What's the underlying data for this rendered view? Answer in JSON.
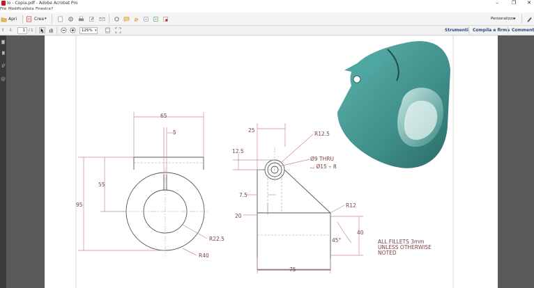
{
  "window": {
    "title": "lo - Copia.pdf - Adobe Acrobat Pro",
    "controls": [
      "–",
      "❐",
      "✕"
    ]
  },
  "menu": [
    "File",
    "Modifica",
    "Vista",
    "Finestra",
    "?"
  ],
  "toolbar": {
    "open_label": "Apri",
    "create_label": "Crea",
    "customize_label": "Personalizza"
  },
  "nav": {
    "page_current": "1",
    "page_total": "/ 1",
    "zoom": "125%"
  },
  "panes": {
    "tools": "Strumenti",
    "fill_sign": "Compila e firma",
    "comment": "Commento"
  },
  "drawing": {
    "dims": {
      "d65": "65",
      "d5": "5",
      "d55": "55",
      "d95": "95",
      "r225": "R22.5",
      "r40": "R40",
      "d25": "25",
      "r125": "R12.5",
      "d125": "12.5",
      "hole": "Ø9 THRU",
      "cbore": "⌴ Ø15 ⫟ 8",
      "d75a": "7.5",
      "d20": "20",
      "r12": "R12",
      "d40": "40",
      "ang": "45°",
      "d75": "75"
    },
    "notes": [
      "ALL FILLETS 3mm",
      "UNLESS OTHERWISE",
      "NOTED"
    ]
  },
  "colors": {
    "accent": "#c4161c",
    "model": "#3f8f8a",
    "dimension": "#c88a8a"
  }
}
